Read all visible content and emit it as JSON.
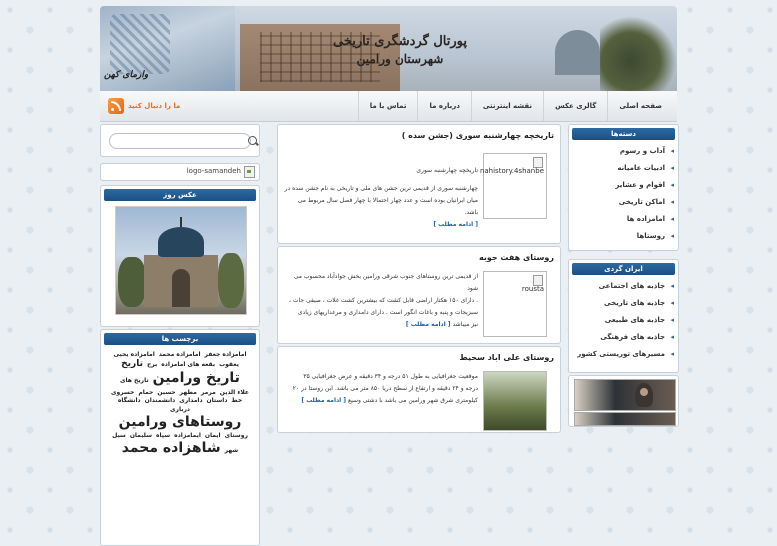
{
  "header": {
    "title_line1": "پورتال گردشگری تاریخی",
    "title_line2": "شهرستان ورامین",
    "signature": "وارمای کهن"
  },
  "nav": {
    "items": [
      "صفحه اصلی",
      "گالری عکس",
      "نقشه اینترنتی",
      "درباره ما",
      "تماس با ما"
    ],
    "rss_label": "ما را دنبال کنید"
  },
  "left": {
    "logo_alt": "logo-samandeh",
    "photo_title": "عکس روز",
    "tags_title": "برچسب ها",
    "tags": [
      {
        "t": "امامزاده جعفر",
        "s": 6
      },
      {
        "t": "امامزاده محمد",
        "s": 6
      },
      {
        "t": "امامزاده یحیی",
        "s": 6
      },
      {
        "t": "یعقوب",
        "s": 6
      },
      {
        "t": "بقعه های امامزاده",
        "s": 6
      },
      {
        "t": "برج",
        "s": 6
      },
      {
        "t": "تاریخ",
        "s": 9
      },
      {
        "t": "تاریخ ورامین",
        "s": 14
      },
      {
        "t": "تاریخ های",
        "s": 6
      },
      {
        "t": "علاء الدین",
        "s": 6
      },
      {
        "t": "مرمر",
        "s": 6
      },
      {
        "t": "مطهر",
        "s": 6
      },
      {
        "t": "حسین",
        "s": 6
      },
      {
        "t": "حمام",
        "s": 6
      },
      {
        "t": "خسروی",
        "s": 6
      },
      {
        "t": "خط",
        "s": 6
      },
      {
        "t": "داستان",
        "s": 6
      },
      {
        "t": "دامداری",
        "s": 6
      },
      {
        "t": "دانشمندان",
        "s": 6
      },
      {
        "t": "دانشگاه",
        "s": 6
      },
      {
        "t": "درباری",
        "s": 6
      },
      {
        "t": "روستاهای ورامین",
        "s": 14
      },
      {
        "t": "روستای",
        "s": 6
      },
      {
        "t": "ایمان",
        "s": 6
      },
      {
        "t": "ایمامزاده",
        "s": 6
      },
      {
        "t": "سپاه",
        "s": 6
      },
      {
        "t": "سلیمان",
        "s": 6
      },
      {
        "t": "سیل",
        "s": 6
      },
      {
        "t": "شهر",
        "s": 6
      },
      {
        "t": "شاهزاده محمد",
        "s": 14
      }
    ]
  },
  "posts": [
    {
      "title": "تاریخچه چهارشنبه سوری (جشن سده )",
      "thumb_alt": "nahistory.4shanbe",
      "text_lines": [
        "تاریخچه چهارشنبه سوری",
        "",
        "چهارشنبه سوری از قدیمی ترین جشن های ملی و تاریخی به نام جشن سده در",
        "میان ایرانیان بوده است و عدد چهار احتمالا با چهار فصل سال مربوط می باشد."
      ],
      "more": "[ ادامه مطلب ]"
    },
    {
      "title": "روستای هفت جوبه",
      "thumb_alt": "rousta",
      "text_lines": [
        "از قدیمی ترین روستاهای جنوب شرقی ورامین بخش جوادآباد محسوب می شود",
        ". دارای ۱۵۰ هکتار اراضی قابل کشت که بیشترین کشت غلات ، صیفی جات ،",
        "سبزیجات و پنبه و باغات انگور است . دارای دامداری و مرغداریهای زیادی",
        "نیز میباشد"
      ],
      "more": "[ ادامه مطلب ]"
    },
    {
      "title": "روستای علی اباد سحیط",
      "thumb_alt": "",
      "text_lines": [
        "موقعیت جغرافیایی به طول ۵۱ درجه و ۳۴ دقیقه و عرض جغرافیایی ۳۵",
        "درجه و ۲۴ دقیقه و ارتفاع از سطح دریا ۸۵۰ متر می باشد. این روستا در ۲۰",
        "کیلومتری شرق شهر ورامین می باشد با دشتی وسیع"
      ],
      "more": "[ ادامه مطلب ]"
    }
  ],
  "right": {
    "cat_title": "دسته‌ها",
    "categories": [
      "آداب و رسوم",
      "ادبیات عامیانه",
      "اقوام و عشایر",
      "اماکن تاریخی",
      "امامزاده ها",
      "روستاها"
    ],
    "iran_title": "ایران گردی",
    "iran_items": [
      "جاذبه های اجتماعی",
      "جاذبه های تاریخی",
      "جاذبه های طبیعی",
      "جاذبه های فرهنگی",
      "مسیرهای توریستی کشور"
    ]
  }
}
